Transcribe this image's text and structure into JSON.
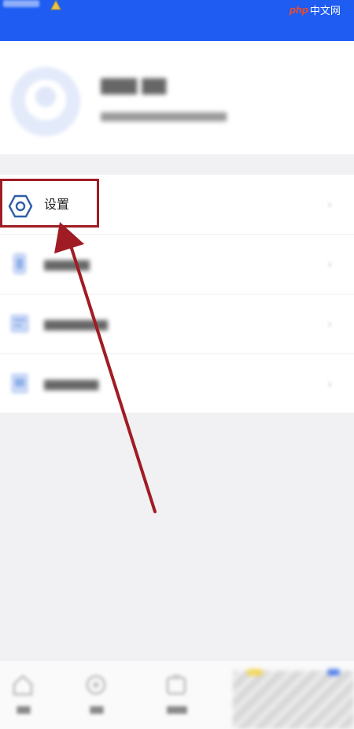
{
  "colors": {
    "status_bar": "#1e5cf2",
    "background": "#f1f1f3",
    "card": "#ffffff",
    "highlight": "#a01c24",
    "icon_blue": "#2e5ea8"
  },
  "watermark": {
    "php": "php",
    "cn": "中文网"
  },
  "header": {
    "avatar_icon": "user-avatar-icon"
  },
  "menu": {
    "items": [
      {
        "label": "设置",
        "icon": "settings-hexagon-icon"
      },
      {
        "icon": "download-icon"
      },
      {
        "icon": "records-icon"
      },
      {
        "icon": "feedback-icon"
      }
    ]
  },
  "annotation": {
    "type": "highlight-box-with-arrow",
    "target": "menu.items.0"
  },
  "tabbar": {
    "tabs": [
      {
        "icon": "home-icon"
      },
      {
        "icon": "discover-icon"
      },
      {
        "icon": "study-icon"
      }
    ]
  }
}
